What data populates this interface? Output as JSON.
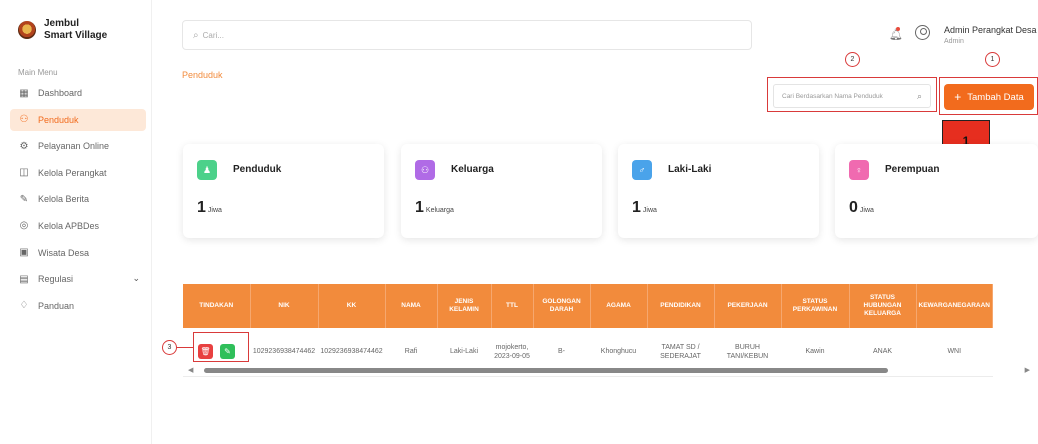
{
  "brand": {
    "line1": "Jembul",
    "line2": "Smart Village"
  },
  "sidebar": {
    "menu_title": "Main Menu",
    "items": [
      {
        "label": "Dashboard",
        "icon": "grid-icon",
        "active": false
      },
      {
        "label": "Penduduk",
        "icon": "users-icon",
        "active": true
      },
      {
        "label": "Pelayanan Online",
        "icon": "service-icon",
        "active": false
      },
      {
        "label": "Kelola Perangkat",
        "icon": "device-icon",
        "active": false
      },
      {
        "label": "Kelola Berita",
        "icon": "edit-icon",
        "active": false
      },
      {
        "label": "Kelola APBDes",
        "icon": "money-icon",
        "active": false
      },
      {
        "label": "Wisata Desa",
        "icon": "image-icon",
        "active": false
      },
      {
        "label": "Regulasi",
        "icon": "document-icon",
        "active": false
      },
      {
        "label": "Panduan",
        "icon": "guide-icon",
        "active": false
      }
    ]
  },
  "header": {
    "search_placeholder": "Cari...",
    "user_name": "Admin Perangkat Desa",
    "user_role": "Admin"
  },
  "breadcrumb": "Penduduk",
  "markers": {
    "m1": "1",
    "m2": "2",
    "m3": "3",
    "label": "1"
  },
  "filter_placeholder": "Cari Berdasarkan Nama Penduduk",
  "add_button": {
    "plus": "+",
    "label": "Tambah Data"
  },
  "colors": {
    "accent": "#f26b1d",
    "accent_light": "#f28b3c",
    "green": "#4cd18a",
    "purple": "#b06be6",
    "blue": "#4aa3ea",
    "pink": "#f06ab0"
  },
  "cards": [
    {
      "title": "Penduduk",
      "value": "1",
      "unit": "Jiwa"
    },
    {
      "title": "Keluarga",
      "value": "1",
      "unit": "Keluarga"
    },
    {
      "title": "Laki-Laki",
      "value": "1",
      "unit": "Jiwa"
    },
    {
      "title": "Perempuan",
      "value": "0",
      "unit": "Jiwa"
    }
  ],
  "table": {
    "headers": [
      "TINDAKAN",
      "NIK",
      "KK",
      "NAMA",
      "JENIS KELAMIN",
      "TTL",
      "GOLONGAN DARAH",
      "AGAMA",
      "PENDIDIKAN",
      "PEKERJAAN",
      "STATUS PERKAWINAN",
      "STATUS HUBUNGAN KELUARGA",
      "KEWARGANEGARAAN"
    ],
    "rows": [
      [
        "",
        "1029236938474462",
        "1029236938474462",
        "Rafi",
        "Laki-Laki",
        "mojokerto, 2023-09-05",
        "B-",
        "Khonghucu",
        "TAMAT SD / SEDERAJAT",
        "BURUH TANI/KEBUN",
        "Kawin",
        "ANAK",
        "WNI"
      ]
    ]
  }
}
